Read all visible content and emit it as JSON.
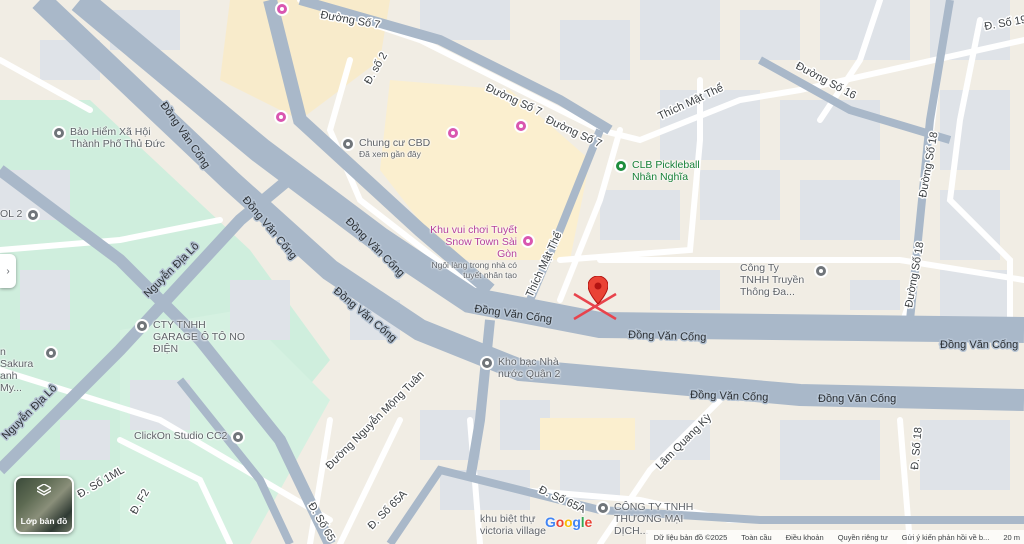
{
  "roads": {
    "dong_van_cong": "Đồng Văn Cống",
    "duong_so_7": "Đường Số 7",
    "duong_so_16": "Đường Số 16",
    "duong_so_18": "Đường Số 18",
    "duong_so_19": "Đ. Số 19",
    "d_so_2": "Đ. số 2",
    "thich_mat_the": "Thích Mật Thể",
    "nguyen_dia_lo": "Nguyễn Địa Lô",
    "duong_nguyen_mong_tuan": "Đường Nguyễn Mộng Tuân",
    "lam_quang_ky": "Lâm Quang Kỳ",
    "d_so_65a": "Đ. Số 65A",
    "d_so_65": "Đ. Số 65",
    "d_so_18_lower": "Đ. Số 18",
    "d_f2": "Đ. F2",
    "d_so_1ml": "Đ. Số 1ML"
  },
  "pois": {
    "bao_hiem": "Bảo Hiểm Xã Hội Thành Phố Thủ Đức",
    "chung_cu_name": "Chung cư CBD",
    "chung_cu_sub": "Đã xem gần đây",
    "pickleball": "CLB Pickleball Nhân Nghĩa",
    "khu_vui_choi": "Khu vui chơi Tuyết Snow Town Sài Gòn",
    "khu_vui_choi_sub": "Ngôi làng trong nhà có tuyết nhân tạo",
    "cong_ty_truyen_thong": "Công Ty TNHH Truyền Thông Đa...",
    "garage": "CTY TNHH GARAGE Ô TÔ NO ĐIỆN",
    "kho_bac": "Kho bạc Nhà nước Quận 2",
    "clickon": "ClickOn Studio CC2",
    "cong_ty_thuong_mai": "CÔNG TY TNHH THƯƠNG MẠI DỊCH...",
    "victoria": "khu biệt thự victoria village",
    "sakura": "n Sakura anh My...",
    "left_edge": "OL 2"
  },
  "controls": {
    "layer_label": "Lớp bản đồ",
    "side_toggle": "›"
  },
  "branding": {
    "logo_letters": [
      "G",
      "o",
      "o",
      "g",
      "l",
      "e"
    ],
    "logo_colors": [
      "#4285f4",
      "#ea4335",
      "#fbbc05",
      "#4285f4",
      "#34a853",
      "#ea4335"
    ]
  },
  "attribution": {
    "data": "Dữ liệu bản đồ ©2025",
    "global": "Toàn cầu",
    "terms": "Điều khoản",
    "privacy": "Quyền riêng tư",
    "feedback": "Gửi ý kiến phản hồi về b...",
    "scale": "20 m"
  },
  "colors": {
    "land": "#f1ede4",
    "park": "#cfeedd",
    "road_major": "#a9b8c9",
    "building": "#dfe3e8",
    "marker": "#ea4335"
  }
}
